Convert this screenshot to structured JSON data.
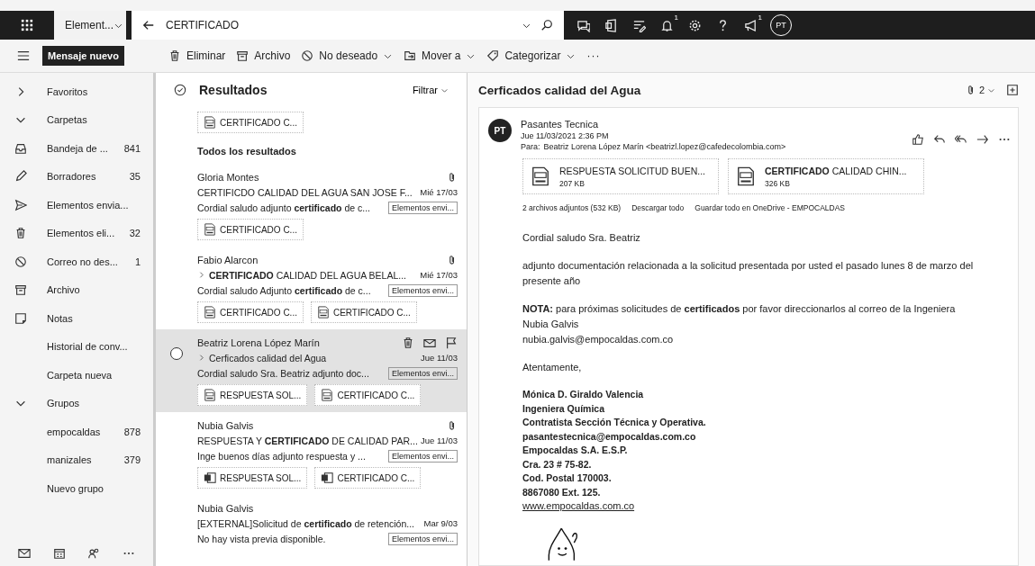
{
  "topbar": {
    "folder_scope": "Element...",
    "search_value": "CERTIFICADO",
    "bell_badge": "1",
    "megaphone_badge": "1",
    "avatar": "PT"
  },
  "new_message": "Mensaje nuevo",
  "toolbar": [
    {
      "label": "Eliminar",
      "dropdown": false
    },
    {
      "label": "Archivo",
      "dropdown": false
    },
    {
      "label": "No deseado",
      "dropdown": true
    },
    {
      "label": "Mover a",
      "dropdown": true
    },
    {
      "label": "Categorizar",
      "dropdown": true
    }
  ],
  "toolbar_more": "···",
  "sidebar": {
    "items": [
      {
        "kind": "header",
        "label": "Favoritos",
        "expanded": false
      },
      {
        "kind": "header",
        "label": "Carpetas",
        "expanded": true
      },
      {
        "kind": "folder",
        "label": "Bandeja de ...",
        "count": "841"
      },
      {
        "kind": "folder",
        "label": "Borradores",
        "count": "35"
      },
      {
        "kind": "folder",
        "label": "Elementos envia..."
      },
      {
        "kind": "folder",
        "label": "Elementos eli...",
        "count": "32"
      },
      {
        "kind": "folder",
        "label": "Correo no des...",
        "count": "1"
      },
      {
        "kind": "folder",
        "label": "Archivo"
      },
      {
        "kind": "folder",
        "label": "Notas"
      },
      {
        "kind": "folder",
        "label": "Historial de conv..."
      },
      {
        "kind": "folder",
        "label": "Carpeta nueva"
      },
      {
        "kind": "header",
        "label": "Grupos",
        "expanded": true
      },
      {
        "kind": "folder",
        "label": "empocaldas",
        "count": "878"
      },
      {
        "kind": "folder",
        "label": "manizales",
        "count": "379"
      },
      {
        "kind": "folder",
        "label": "Nuevo grupo"
      }
    ]
  },
  "results": {
    "title": "Resultados",
    "filter": "Filtrar",
    "top_attachments": [
      "CERTIFICADO C..."
    ],
    "section": "Todos los resultados",
    "messages": [
      {
        "sender": "Gloria Montes",
        "thread": false,
        "subject": "CERTIFICDO CALIDAD DEL AGUA SAN JOSE F...",
        "date": "Mié 17/03",
        "preview": "Cordial saludo adjunto **certificado** de c...",
        "folder": "Elementos envi...",
        "attachment_icon": true,
        "selected": false,
        "attachments": [
          {
            "kind": "pdf",
            "name": "CERTIFICADO C..."
          }
        ]
      },
      {
        "sender": "Fabio Alarcon",
        "thread": true,
        "subject": "**CERTIFICADO** CALIDAD DEL AGUA BELAL...",
        "date": "Mié 17/03",
        "preview": "Cordial saludo Adjunto **certificado** de c...",
        "folder": "Elementos envi...",
        "attachment_icon": true,
        "selected": false,
        "attachments": [
          {
            "kind": "pdf",
            "name": "CERTIFICADO C..."
          },
          {
            "kind": "pdf",
            "name": "CERTIFICADO C..."
          }
        ]
      },
      {
        "sender": "Beatriz Lorena López Marín",
        "thread": true,
        "subject": "Cerficados calidad del Agua",
        "date": "Jue 11/03",
        "preview": "Cordial saludo Sra. Beatriz adjunto doc...",
        "folder": "Elementos envi...",
        "attachment_icon": false,
        "selected": true,
        "attachments": [
          {
            "kind": "pdf",
            "name": "RESPUESTA SOL..."
          },
          {
            "kind": "pdf",
            "name": "CERTIFICADO C..."
          }
        ]
      },
      {
        "sender": "Nubia Galvis",
        "thread": false,
        "subject": "RESPUESTA Y **CERTIFICADO** DE CALIDAD PAR...",
        "date": "Jue 11/03",
        "preview": "Inge buenos días adjunto respuesta y ...",
        "folder": "Elementos envi...",
        "attachment_icon": true,
        "selected": false,
        "attachments": [
          {
            "kind": "word",
            "name": "RESPUESTA SOL..."
          },
          {
            "kind": "word",
            "name": "CERTIFICADO C..."
          }
        ]
      },
      {
        "sender": "Nubia Galvis",
        "thread": false,
        "subject": "[EXTERNAL]Solicitud de **certificado** de retención...",
        "date": "Mar 9/03",
        "preview": "No hay vista previa disponible.",
        "folder": "Elementos envi...",
        "attachment_icon": false,
        "selected": false
      }
    ]
  },
  "reading": {
    "subject": "Cerficados calidad del Agua",
    "attachment_count": "2",
    "avatar": "PT",
    "sender": "Pasantes Tecnica",
    "date": "Jue 11/03/2021 2:36 PM",
    "to_label": "Para:",
    "to": "Beatriz Lorena López Marín <beatrizl.lopez@cafedecolombia.com>",
    "attachments": [
      {
        "name": "RESPUESTA SOLICITUD BUEN...",
        "size": "207 KB"
      },
      {
        "name": "**CERTIFICADO** CALIDAD CHIN...",
        "size": "326 KB"
      }
    ],
    "attachment_summary": "2 archivos adjuntos (532 KB)",
    "download_all": "Descargar todo",
    "save_all": "Guardar todo en OneDrive - EMPOCALDAS",
    "body": [
      {
        "kind": "para",
        "lines": [
          "Cordial saludo Sra. Beatriz"
        ]
      },
      {
        "kind": "para",
        "lines": [
          "adjunto documentación relacionada a la solicitud presentada por usted el pasado lunes 8 de marzo del presente año"
        ]
      },
      {
        "kind": "para",
        "lines": [
          "**NOTA:** para próximas solicitudes de **certificados** por favor direccionarlos al correo de la Ingeniera",
          "Nubia Galvis",
          "nubia.galvis@empocaldas.com.co"
        ]
      },
      {
        "kind": "para",
        "lines": [
          "Atentamente,"
        ]
      },
      {
        "kind": "signature",
        "lines": [
          "Mónica D. Giraldo Valencia",
          "Ingeniera Química",
          "Contratista Sección Técnica y Operativa.",
          "pasantestecnica@empocaldas.com.co",
          "Empocaldas S.A. E.S.P.",
          "Cra. 23 # 75-82.",
          "Cod. Postal 170003.",
          "8867080 Ext. 125."
        ],
        "link": "www.empocaldas.com.co"
      }
    ]
  }
}
